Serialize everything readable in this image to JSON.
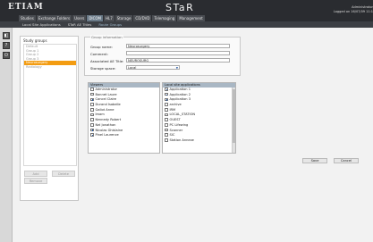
{
  "header": {
    "logo": "ETIAM",
    "app_title": "STaR",
    "user_line1": "Administrator",
    "user_line2": "Logged on 16/07/09 11:1"
  },
  "main_tabs": [
    "Studies",
    "Exchange Folders",
    "Users",
    "DICOM",
    "HL7",
    "Storage",
    "CD/DVD",
    "Telemaging",
    "Management"
  ],
  "main_tabs_active": "DICOM",
  "sub_tabs": [
    "Local Site Applications",
    "STaR AE Titles",
    "Route Groups"
  ],
  "sub_tabs_active": "Route Groups",
  "left_strip": {
    "btn1": "◧",
    "btn2": "?",
    "btn3": "⏻"
  },
  "groups": {
    "title": "Study groups",
    "items": [
      "Default",
      "Group 1",
      "Group 2",
      "Group 3",
      "Neurosurgery",
      "Radiology"
    ],
    "selected": "Neurosurgery",
    "add_label": "Add",
    "delete_label": "Delete",
    "remove_label": "Remove"
  },
  "group_info": {
    "legend": "Group information",
    "name_label": "Group name:",
    "name_value": "Neurosurgery",
    "comment_label": "Comment:",
    "comment_value": "",
    "ae_label": "Associated AE Title:",
    "ae_value": "NEUROSURG",
    "storage_label": "Storage space:",
    "storage_value": "Local"
  },
  "viewers": {
    "header": "Viewers",
    "items": [
      {
        "name": "Administrator",
        "checked": false
      },
      {
        "name": "Bonnet Laure",
        "checked": false
      },
      {
        "name": "Cancel Claire",
        "checked": true
      },
      {
        "name": "Durand Isabelle",
        "checked": false
      },
      {
        "name": "Gallot Anne",
        "checked": false
      },
      {
        "name": "Imam",
        "checked": false
      },
      {
        "name": "Kennedy Robert",
        "checked": false
      },
      {
        "name": "Nel Jonathan",
        "checked": false
      },
      {
        "name": "Nicolas Ghislaine",
        "checked": true
      },
      {
        "name": "Pinel Laurence",
        "checked": true
      }
    ]
  },
  "local_apps": {
    "header": "Local site applications",
    "items": [
      {
        "name": "Application 1",
        "checked": true
      },
      {
        "name": "Application 2",
        "checked": true
      },
      {
        "name": "Application 3",
        "checked": true
      },
      {
        "name": "archive",
        "checked": false
      },
      {
        "name": "IRM",
        "checked": false
      },
      {
        "name": "LOCAL_STATION",
        "checked": false
      },
      {
        "name": "OUEST",
        "checked": false
      },
      {
        "name": "PC Lifewing",
        "checked": false
      },
      {
        "name": "Scanner",
        "checked": false
      },
      {
        "name": "SIC",
        "checked": false
      },
      {
        "name": "Station Annexe",
        "checked": false
      }
    ]
  },
  "actions": {
    "save_label": "Save",
    "cancel_label": "Cancel"
  }
}
